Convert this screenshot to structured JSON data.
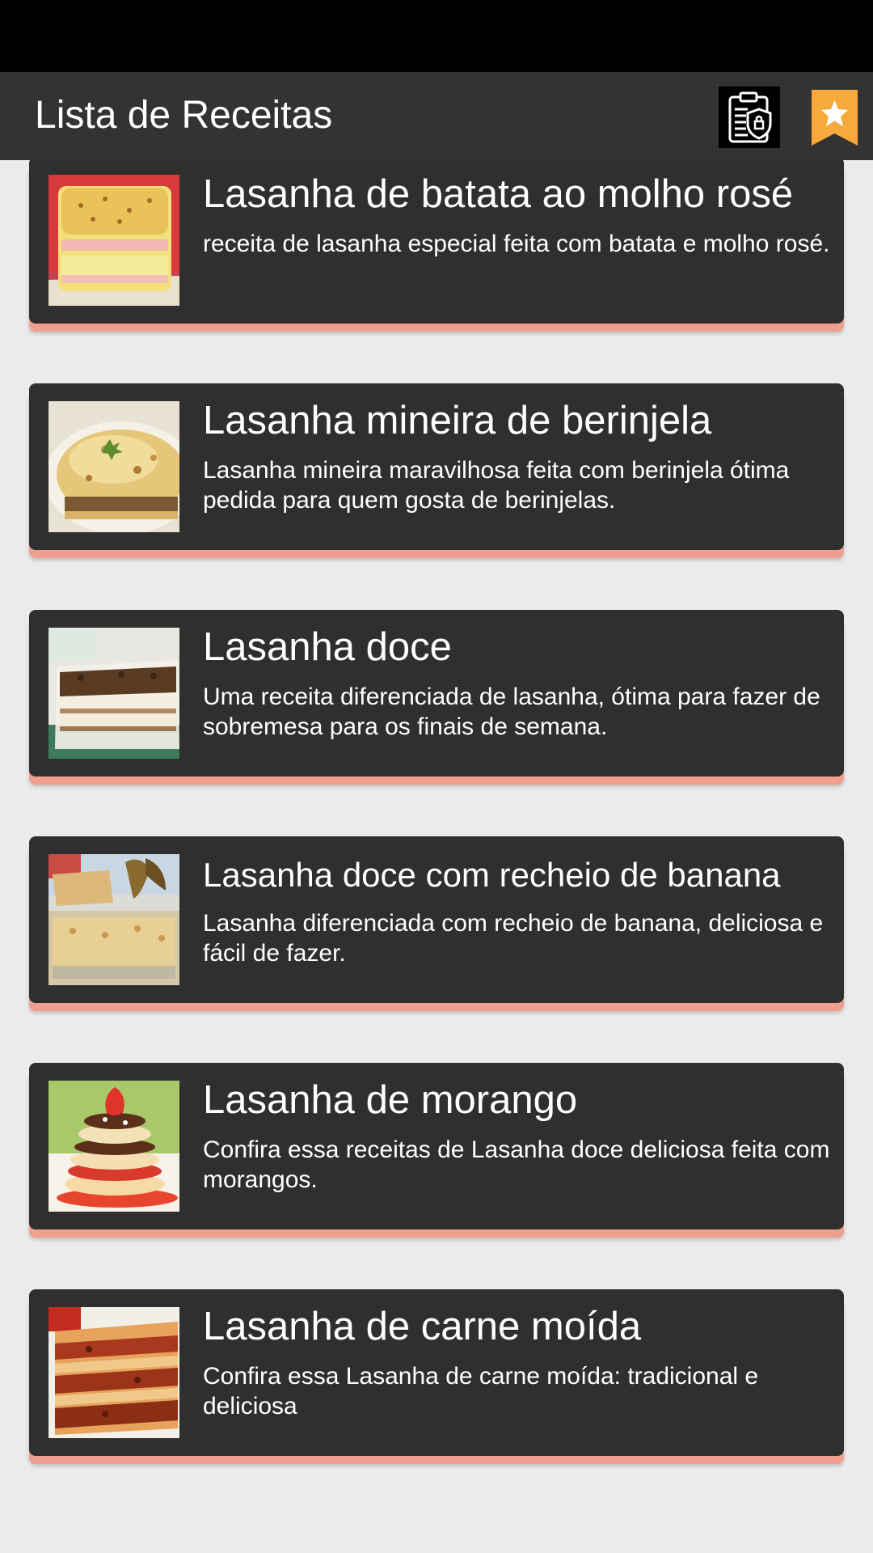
{
  "app_bar": {
    "title": "Lista de Receitas",
    "icons": [
      "privacy-policy-icon",
      "star-bookmark-icon"
    ],
    "accent_color": "#f7a93b"
  },
  "recipes": [
    {
      "title": "Lasanha de batata ao molho rosé",
      "description": "receita de lasanha especial feita com batata e molho rosé."
    },
    {
      "title": "Lasanha mineira de berinjela",
      "description": "Lasanha mineira maravilhosa feita com berinjela ótima pedida para quem gosta de berinjelas."
    },
    {
      "title": "Lasanha doce",
      "description": "Uma receita diferenciada de lasanha, ótima para fazer de sobremesa para os finais de semana."
    },
    {
      "title": "Lasanha doce com recheio de banana",
      "description": "Lasanha diferenciada com recheio de banana, deliciosa e fácil de fazer."
    },
    {
      "title": "Lasanha de morango",
      "description": "Confira essa receitas de Lasanha doce deliciosa feita com morangos."
    },
    {
      "title": "Lasanha de carne moída",
      "description": "Confira essa Lasanha de carne moída: tradicional e deliciosa"
    }
  ],
  "colors": {
    "card_background": "#2f2f2f",
    "card_bottom_border": "#ef9f8e",
    "page_background": "#ebebeb"
  }
}
